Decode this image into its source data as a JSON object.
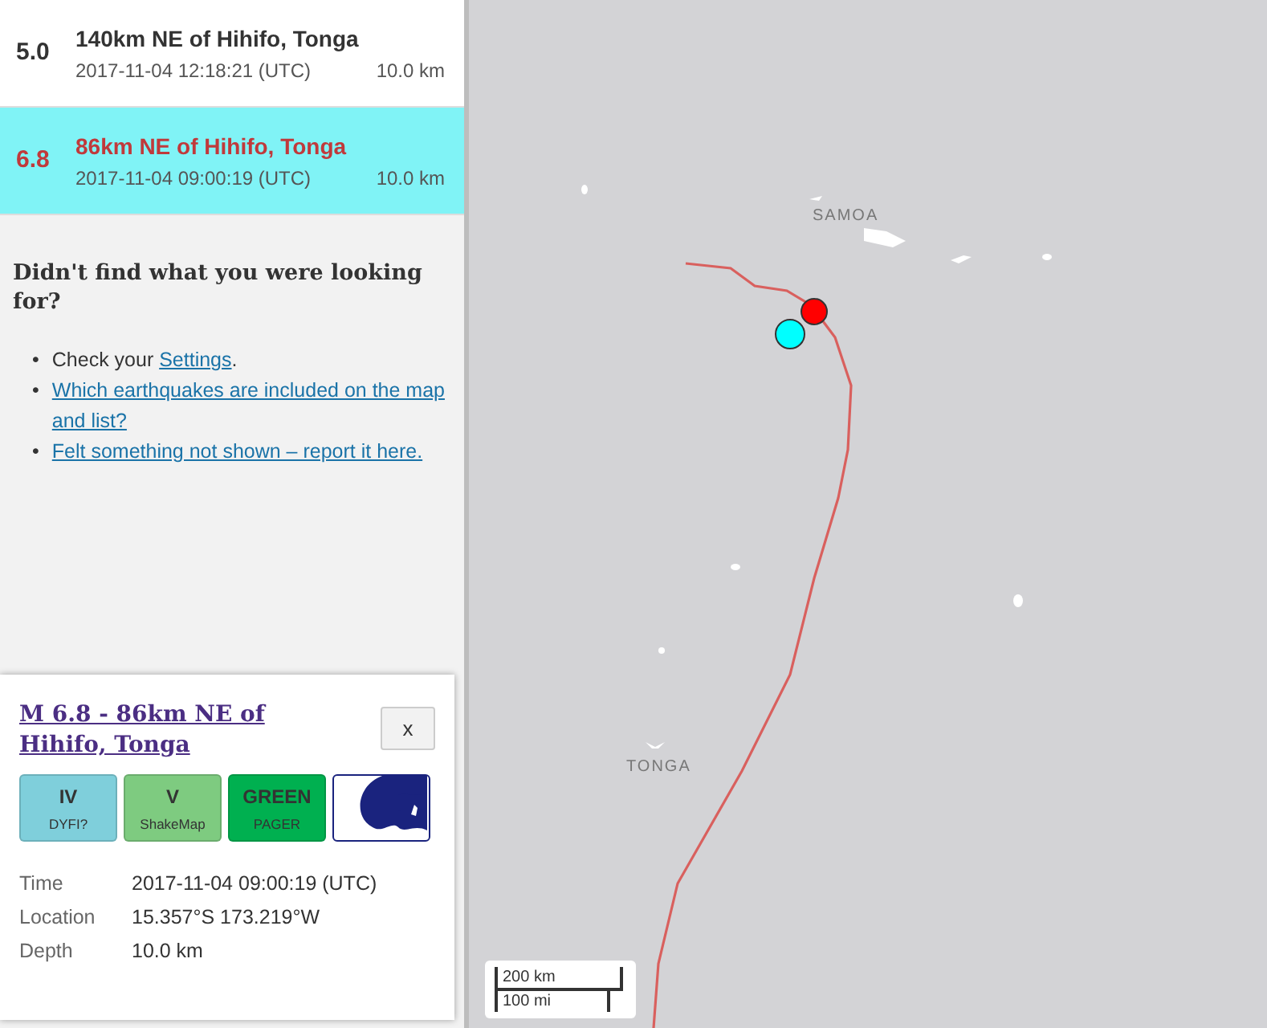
{
  "events": [
    {
      "magnitude": "5.0",
      "title": "140km NE of Hihifo, Tonga",
      "time": "2017-11-04 12:18:21 (UTC)",
      "depth": "10.0 km",
      "selected": false
    },
    {
      "magnitude": "6.8",
      "title": "86km NE of Hihifo, Tonga",
      "time": "2017-11-04 09:00:19 (UTC)",
      "depth": "10.0 km",
      "selected": true
    }
  ],
  "help": {
    "heading": "Didn't find what you were looking for?",
    "items": [
      {
        "marker": "•",
        "text": "Check your ",
        "link": "Settings",
        "after": "."
      },
      {
        "marker": "•",
        "link": "Which earthquakes are included on the map and list?"
      },
      {
        "marker": "•",
        "link": "Felt something not shown – report it here."
      }
    ]
  },
  "popup": {
    "title": "M 6.8 - 86km NE of Hihifo, Tonga",
    "close": "x",
    "badges": [
      {
        "kind": "text",
        "value": "IV",
        "label": "DYFI?",
        "color": "#7fcfdb"
      },
      {
        "kind": "text",
        "value": "V",
        "label": "ShakeMap",
        "color": "#7ecb80"
      },
      {
        "kind": "text",
        "value": "GREEN",
        "label": "PAGER",
        "color": "#00b050"
      },
      {
        "kind": "tsunami",
        "color": "#1a237e"
      }
    ],
    "details": [
      {
        "label": "Time",
        "value": "2017-11-04 09:00:19 (UTC)"
      },
      {
        "label": "Location",
        "value": "15.357°S 173.219°W"
      },
      {
        "label": "Depth",
        "value": "10.0 km"
      }
    ]
  },
  "map": {
    "labels": [
      {
        "text": "SAMOA"
      },
      {
        "text": "TONGA"
      }
    ],
    "scale": {
      "metric": "200 km",
      "imperial": "100 mi"
    }
  }
}
